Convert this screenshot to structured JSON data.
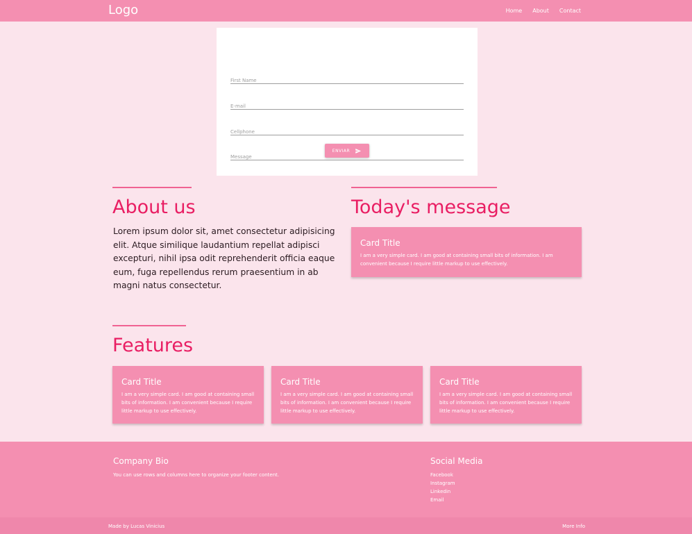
{
  "nav": {
    "logo": "Logo",
    "links": [
      "Home",
      "About",
      "Contact"
    ]
  },
  "form": {
    "first_name_placeholder": "First Name",
    "email_placeholder": "E-mail",
    "cellphone_placeholder": "Cellphone",
    "message_placeholder": "Message",
    "submit_label": "ENVIAR"
  },
  "about": {
    "heading": "About us",
    "text": "Lorem ipsum dolor sit, amet consectetur adipisicing elit. Atque similique laudantium repellat adipisci excepturi, nihil ipsa odit reprehenderit officia eaque eum, fuga repellendus rerum praesentium in ab magni natus consectetur."
  },
  "message": {
    "heading": "Today's message",
    "card": {
      "title": "Card Title",
      "text": "I am a very simple card. I am good at containing small bits of information. I am convenient because I require little markup to use effectively."
    }
  },
  "features": {
    "heading": "Features",
    "cards": [
      {
        "title": "Card Title",
        "text": "I am a very simple card. I am good at containing small bits of information. I am convenient because I require little markup to use effectively."
      },
      {
        "title": "Card Title",
        "text": "I am a very simple card. I am good at containing small bits of information. I am convenient because I require little markup to use effectively."
      },
      {
        "title": "Card Title",
        "text": "I am a very simple card. I am good at containing small bits of information. I am convenient because I require little markup to use effectively."
      }
    ]
  },
  "footer": {
    "bio_title": "Company Bio",
    "bio_text": "You can use rows and columns here to organize your footer content.",
    "social_title": "Social Media",
    "social_links": [
      "Facebook",
      "Instagram",
      "Linkedin",
      "Email"
    ]
  },
  "copyright": {
    "text": "Made by Lucas Vinicius",
    "more": "More Info"
  },
  "colors": {
    "primary": "#f48fb1",
    "accent": "#e91e63",
    "background": "#fbe4ec"
  },
  "icons": {
    "submit": "send-icon"
  }
}
